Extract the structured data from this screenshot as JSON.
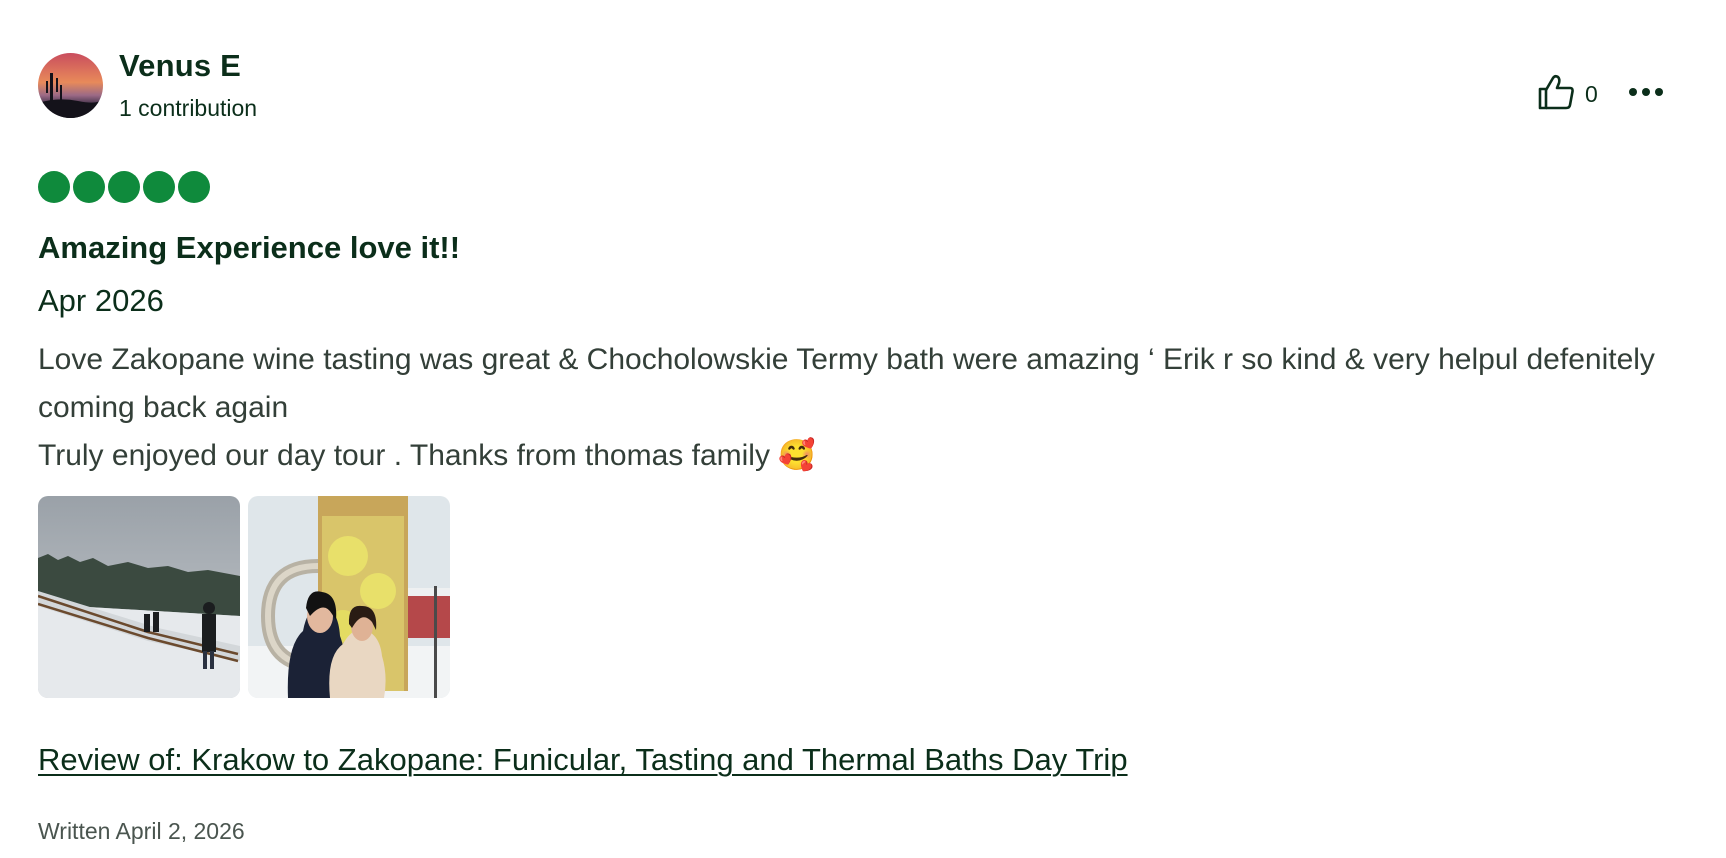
{
  "review": {
    "user": {
      "name": "Venus E",
      "contributions": "1 contribution",
      "avatar_icon": "avatar-sunset-cactus"
    },
    "helpful": {
      "icon": "thumbs-up-icon",
      "count": "0"
    },
    "more_icon": "more-options-icon",
    "rating": {
      "value": 5,
      "max": 5,
      "color": "#0f8a3c"
    },
    "title": "Amazing Experience love it!!",
    "visit_date": "Apr 2026",
    "body_line_1": "Love Zakopane wine tasting was great & Chocholowskie Termy bath were amazing ‘ Erik r so kind & very helpul defenitely coming back again",
    "body_line_2": "Truly enjoyed our day tour . Thanks from thomas family 🥰",
    "photos": [
      {
        "name": "snowy-hill-photo"
      },
      {
        "name": "giant-mug-sculpture-photo"
      }
    ],
    "review_of_link": "Review of: Krakow to Zakopane: Funicular, Tasting and Thermal Baths Day Trip",
    "written_date": "Written April 2, 2026"
  },
  "colors": {
    "text_dark": "#0b2e1a",
    "body_text": "#333f38",
    "bubble_green": "#0f8a3c"
  }
}
